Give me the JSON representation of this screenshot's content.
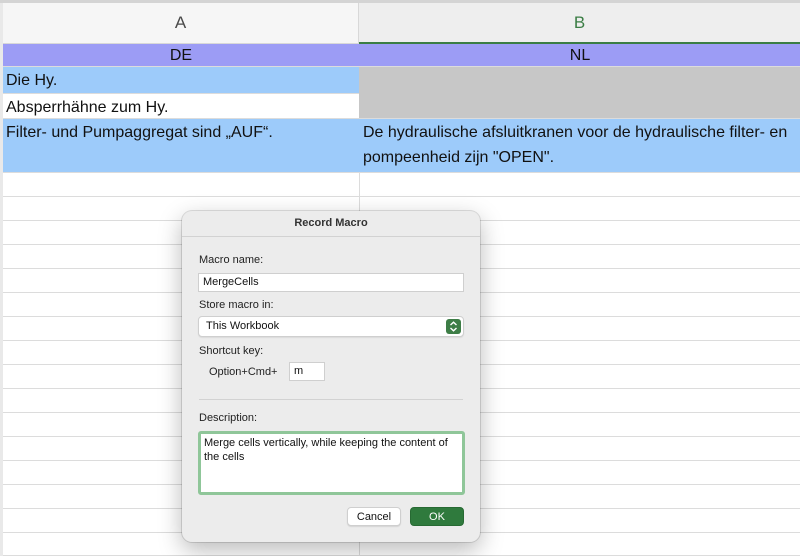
{
  "columns": {
    "a": "A",
    "b": "B"
  },
  "rows": [
    {
      "a": "DE",
      "b": "NL"
    },
    {
      "a": "Die Hy.",
      "b": ""
    },
    {
      "a": "Absperrhähne zum Hy.",
      "b": ""
    },
    {
      "a": "Filter- und Pumpaggregat sind „AUF“.",
      "b": "De hydraulische afsluitkranen voor de hydraulische filter- en pompeenheid zijn \"OPEN\"."
    }
  ],
  "dialog": {
    "title": "Record Macro",
    "macro_name_label": "Macro name:",
    "macro_name_value": "MergeCells",
    "store_label": "Store macro in:",
    "store_value": "This Workbook",
    "shortcut_label": "Shortcut key:",
    "shortcut_prefix": "Option+Cmd+",
    "shortcut_value": "m",
    "description_label": "Description:",
    "description_value": "Merge cells vertically, while keeping the content of the cells",
    "cancel_label": "Cancel",
    "ok_label": "OK"
  },
  "colors": {
    "header_row": "#9c9cf5",
    "highlight_blue": "#9dcbfa",
    "grey_fill": "#c7c7c7",
    "accent_green": "#2f7a3d"
  },
  "icons": {
    "select_arrows": "chevron-up-down-icon"
  }
}
